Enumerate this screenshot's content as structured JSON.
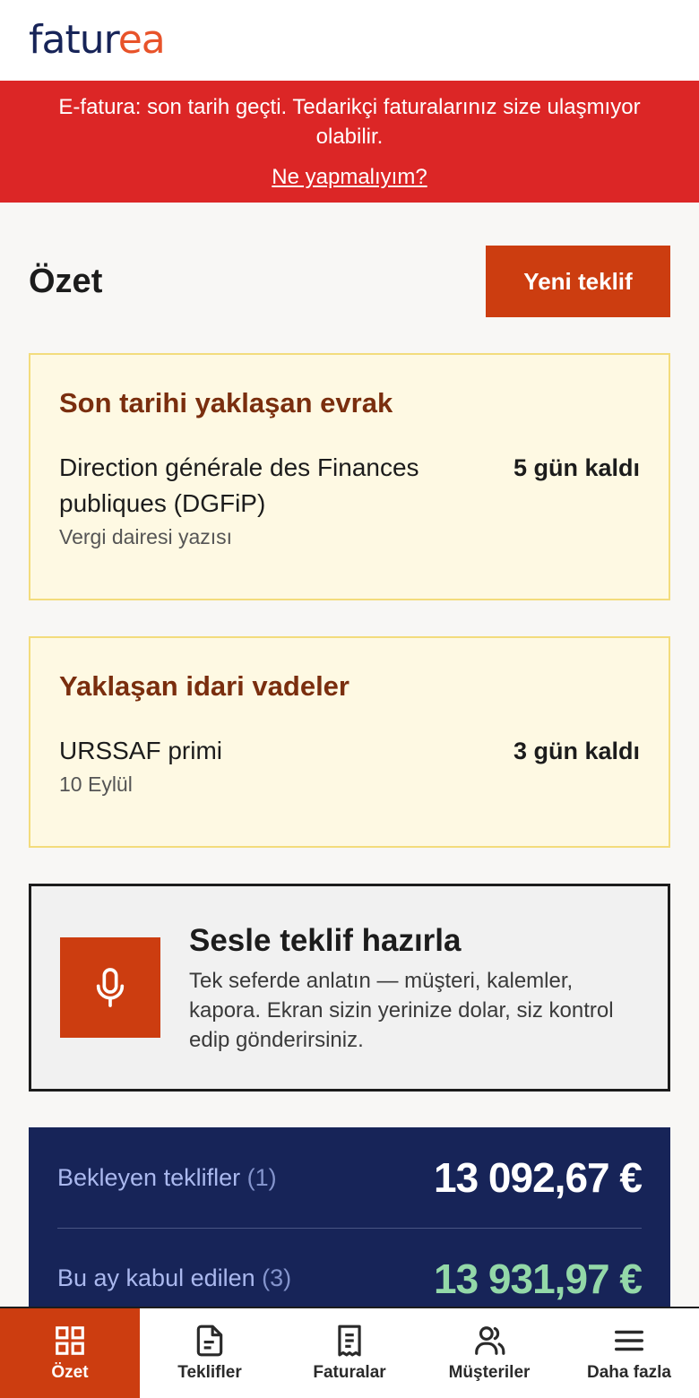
{
  "app": {
    "logo_part1": "fatur",
    "logo_part2": "ea"
  },
  "alert": {
    "message": "E-fatura: son tarih geçti. Tedarikçi faturalarınız size ulaşmıyor olabilir.",
    "link": "Ne yapmalıyım?"
  },
  "page": {
    "title": "Özet",
    "new_button": "Yeni teklif"
  },
  "documents": {
    "title": "Son tarihi yaklaşan evrak",
    "items": [
      {
        "name": "Direction générale des Finances publiques (DGFiP)",
        "sub": "Vergi dairesi yazısı",
        "days": "5 gün kaldı"
      }
    ]
  },
  "admin": {
    "title": "Yaklaşan idari vadeler",
    "items": [
      {
        "name": "URSSAF primi",
        "sub": "10 Eylül",
        "days": "3 gün kaldı"
      }
    ]
  },
  "voice": {
    "title": "Sesle teklif hazırla",
    "description": "Tek seferde anlatın — müşteri, kalemler, kapora. Ekran sizin yerinize dolar, siz kontrol edip gönderirsiniz."
  },
  "stats": [
    {
      "label": "Bekleyen teklifler",
      "count": "(1)",
      "value": "13 092,67 €"
    },
    {
      "label": "Bu ay kabul edilen",
      "count": "(3)",
      "value": "13 931,97 €"
    }
  ],
  "nav": [
    {
      "label": "Özet",
      "icon": "grid-icon",
      "active": true
    },
    {
      "label": "Teklifler",
      "icon": "document-icon"
    },
    {
      "label": "Faturalar",
      "icon": "receipt-icon"
    },
    {
      "label": "Müşteriler",
      "icon": "users-icon"
    },
    {
      "label": "Daha fazla",
      "icon": "menu-icon"
    }
  ],
  "colors": {
    "brand_navy": "#172458",
    "brand_orange": "#cc3d10",
    "alert_red": "#dc2626",
    "positive_green": "#93d8a8"
  }
}
